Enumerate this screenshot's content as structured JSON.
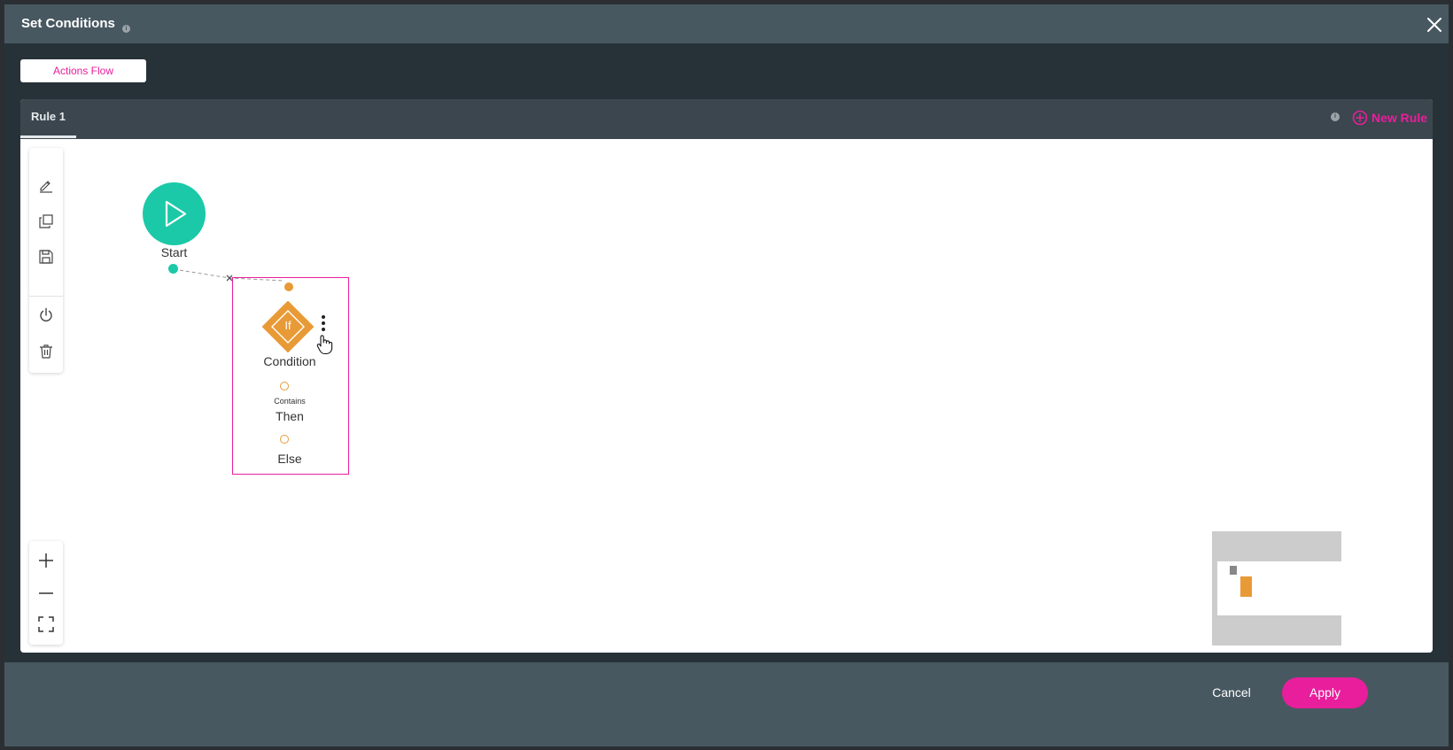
{
  "dialog": {
    "title": "Set Conditions"
  },
  "top_button": {
    "label": "Actions Flow"
  },
  "tabs": [
    {
      "label": "Rule 1",
      "active": true
    }
  ],
  "new_rule": {
    "label": "New Rule"
  },
  "toolbar": {
    "tools": [
      "edit-icon",
      "copy-icon",
      "save-icon",
      "power-icon",
      "trash-icon"
    ]
  },
  "zoom_controls": [
    "zoom-in-icon",
    "zoom-out-icon",
    "fit-screen-icon"
  ],
  "flow": {
    "start": {
      "label": "Start"
    },
    "condition": {
      "icon_text": "If",
      "label": "Condition",
      "then_operator": "Contains",
      "then_label": "Then",
      "else_label": "Else"
    }
  },
  "footer": {
    "cancel_label": "Cancel",
    "apply_label": "Apply"
  },
  "colors": {
    "accent": "#e91e9c",
    "start_node": "#1bc9a8",
    "condition_node": "#e89a36",
    "header": "#485861",
    "background": "#263238"
  }
}
